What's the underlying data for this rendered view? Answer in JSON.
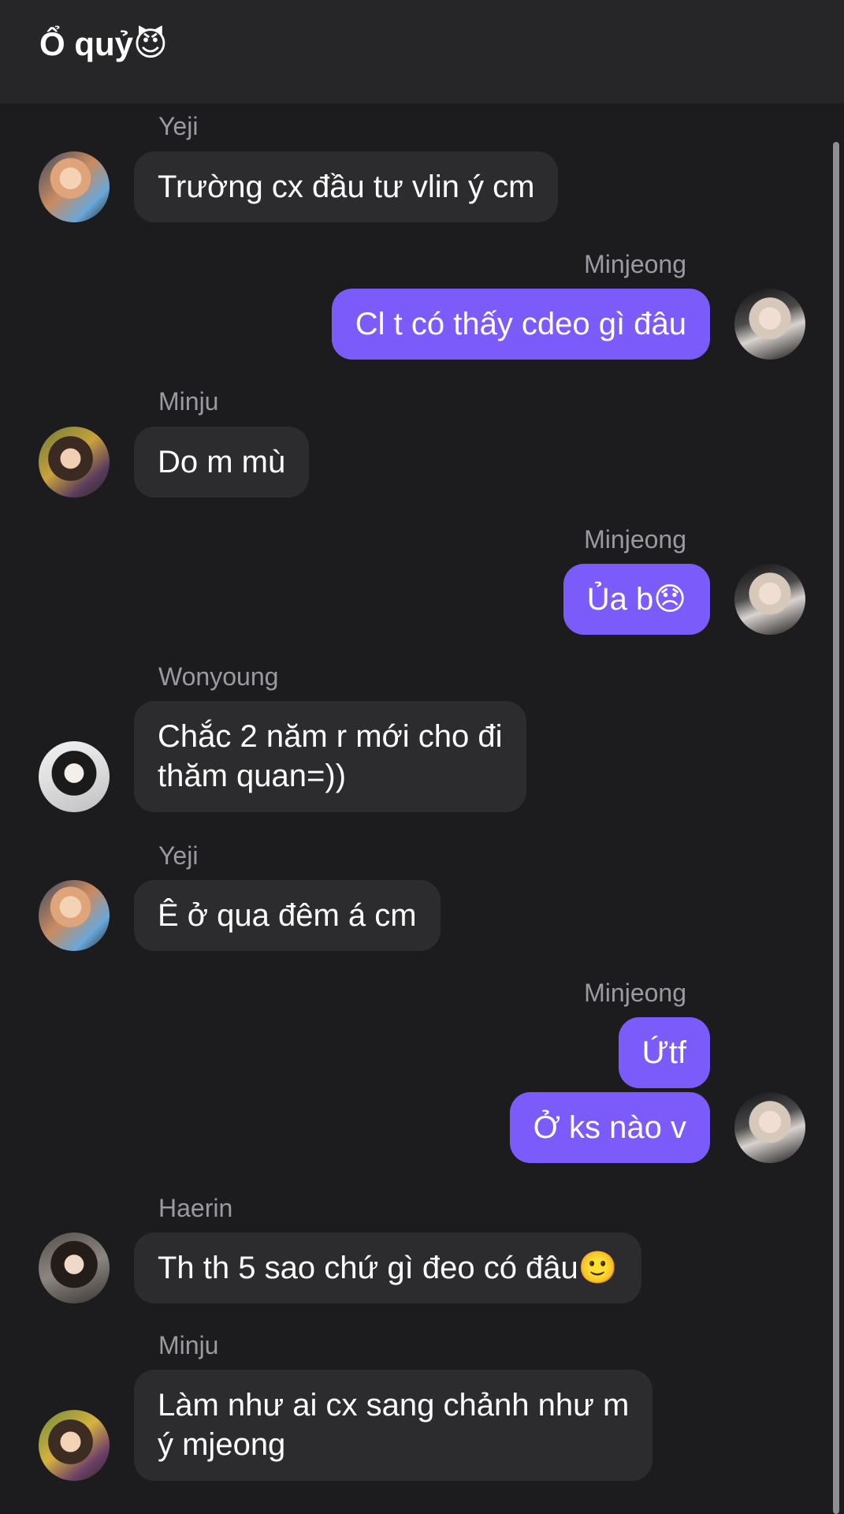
{
  "header": {
    "title": "Ổ quỷ😈"
  },
  "messages": [
    {
      "sender": "Yeji",
      "text": "Trường cx đầu tư vlin ý cm"
    },
    {
      "sender": "Minjeong",
      "text": "Cl t có thấy cdeo gì đâu"
    },
    {
      "sender": "Minju",
      "text": "Do m mù"
    },
    {
      "sender": "Minjeong",
      "text": "Ủa b😞"
    },
    {
      "sender": "Wonyoung",
      "line1": "Chắc 2 năm r mới cho đi",
      "line2": "thăm quan=))"
    },
    {
      "sender": "Yeji",
      "text": "Ê ở qua đêm á cm"
    },
    {
      "sender": "Minjeong",
      "text": "Ứtf"
    },
    {
      "text": "Ở ks nào v"
    },
    {
      "sender": "Haerin",
      "text": "Th th 5 sao chứ gì đeo có đâu🙂"
    },
    {
      "sender": "Minju",
      "line1": "Làm như ai cx sang chảnh như m",
      "line2": "ý mjeong"
    }
  ],
  "colors": {
    "background": "#1c1c1e",
    "header": "#262628",
    "incoming_bubble": "#2c2c2e",
    "outgoing_bubble": "#7b5cfa",
    "sender_name": "#9a9aa0"
  }
}
